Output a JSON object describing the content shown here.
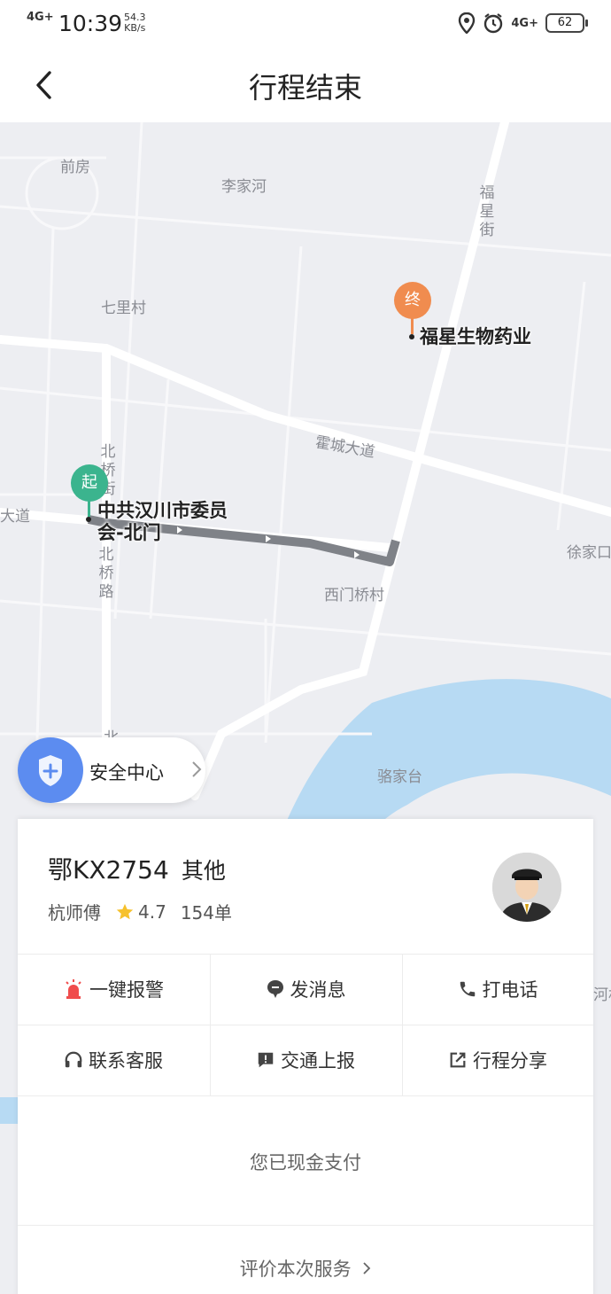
{
  "status_bar": {
    "signal_text": "4G+",
    "time": "10:39",
    "speed_value": "54.3",
    "speed_unit": "KB/s",
    "network": "4G+",
    "battery": "62"
  },
  "header": {
    "title": "行程结束",
    "back_icon": "chevron-left-icon"
  },
  "map": {
    "labels": {
      "qianfang": "前房",
      "lijiahe": "李家河",
      "qilicun": "七里村",
      "huochengdadao": "霍城大道",
      "dadao_left": "大道",
      "ximenqiaocun": "西门桥村",
      "luojiatai": "骆家台",
      "xujia": "徐家口",
      "bei": "北",
      "river_right": "河村"
    },
    "vertical_labels": {
      "fuxingjie": "福星街",
      "beiqiaojie": "北桥街",
      "beiqiaolu": "北桥路"
    },
    "start_pin": "起",
    "end_pin": "终",
    "start_name": "中共汉川市委员会-北门",
    "start_name_line1": "中共汉川市委员",
    "start_name_line2": "会-北门",
    "end_name": "福星生物药业",
    "colors": {
      "start": "#3bb48e",
      "end": "#f08c4f",
      "route": "#7f8288",
      "water": "#b7daf3"
    }
  },
  "safety": {
    "label": "安全中心",
    "icon": "shield-plus-icon"
  },
  "driver": {
    "plate": "鄂KX2754",
    "car_type": "其他",
    "name": "杭师傅",
    "rating": "4.7",
    "orders": "154单"
  },
  "actions": [
    {
      "label": "一键报警",
      "icon": "alarm-icon"
    },
    {
      "label": "发消息",
      "icon": "message-icon"
    },
    {
      "label": "打电话",
      "icon": "phone-icon"
    },
    {
      "label": "联系客服",
      "icon": "headset-icon"
    },
    {
      "label": "交通上报",
      "icon": "report-icon"
    },
    {
      "label": "行程分享",
      "icon": "share-icon"
    }
  ],
  "payment": {
    "status": "您已现金支付"
  },
  "rating_link": "评价本次服务"
}
